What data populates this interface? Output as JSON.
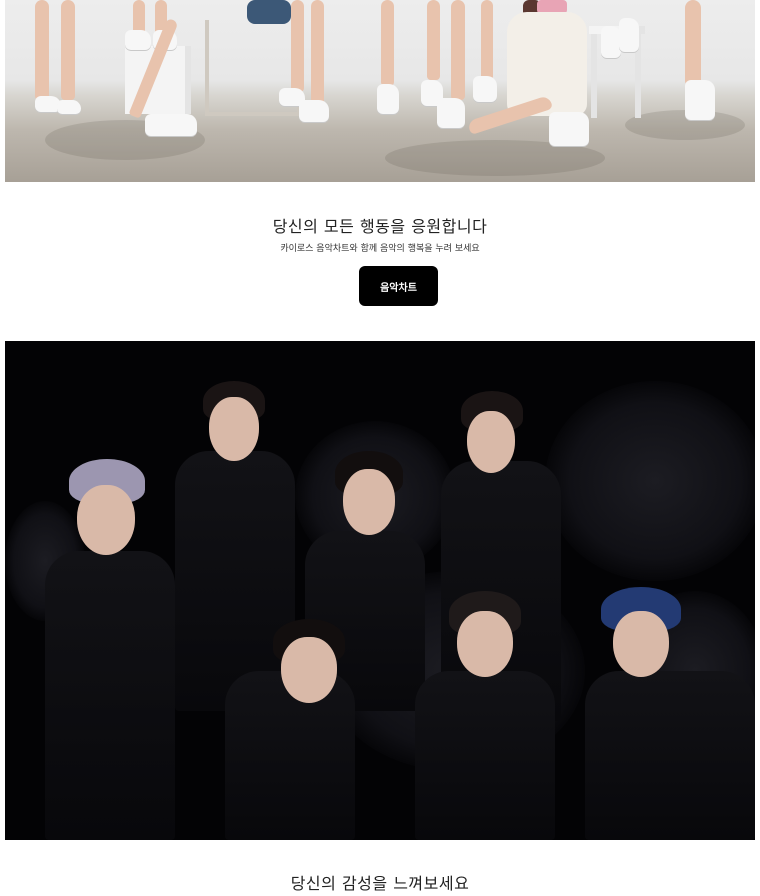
{
  "sections": [
    {
      "heading": "당신의 모든 행동을 응원합니다",
      "subtext": "카이로스 음악차트와 함께 음악의 행복을 누려 보세요",
      "button_label": "음악차트"
    },
    {
      "heading": "당신의 감성을 느껴보세요"
    }
  ],
  "colors": {
    "background": "#ffffff",
    "button_bg": "#000000",
    "button_text": "#ffffff"
  }
}
